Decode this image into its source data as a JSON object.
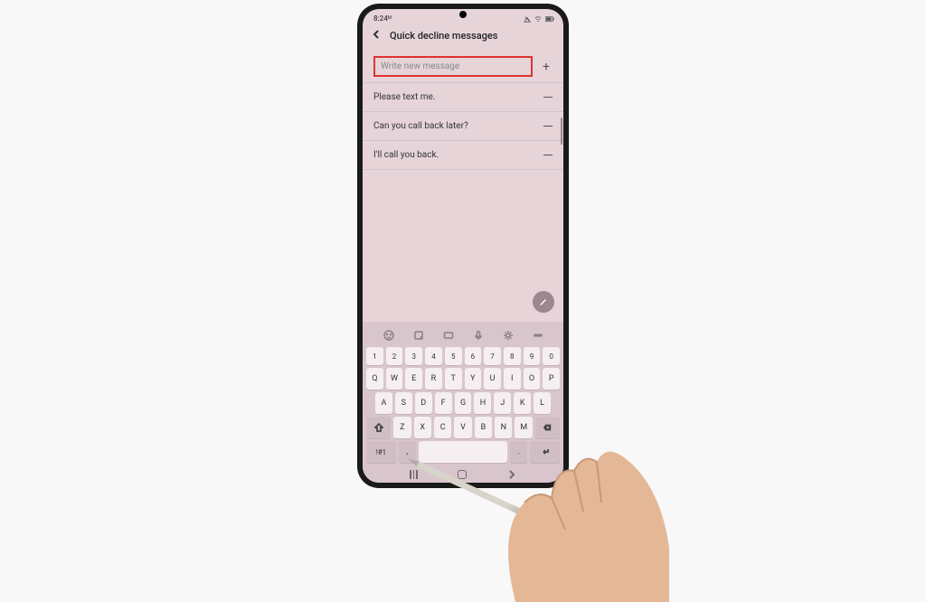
{
  "statusbar": {
    "time": "8:24",
    "ampm_mark": "ᴹ"
  },
  "header": {
    "title": "Quick decline messages"
  },
  "input": {
    "placeholder": "Write new message"
  },
  "messages": [
    {
      "text": "Please text me."
    },
    {
      "text": "Can you call back later?"
    },
    {
      "text": "I'll call you back."
    }
  ],
  "keyboard": {
    "num_row": [
      "1",
      "2",
      "3",
      "4",
      "5",
      "6",
      "7",
      "8",
      "9",
      "0"
    ],
    "row1": [
      "Q",
      "W",
      "E",
      "R",
      "T",
      "Y",
      "U",
      "I",
      "O",
      "P"
    ],
    "row2": [
      "A",
      "S",
      "D",
      "F",
      "G",
      "H",
      "J",
      "K",
      "L"
    ],
    "row3": [
      "Z",
      "X",
      "C",
      "V",
      "B",
      "N",
      "M"
    ],
    "sym_label": "!#1",
    "comma": ",",
    "dot": "."
  }
}
